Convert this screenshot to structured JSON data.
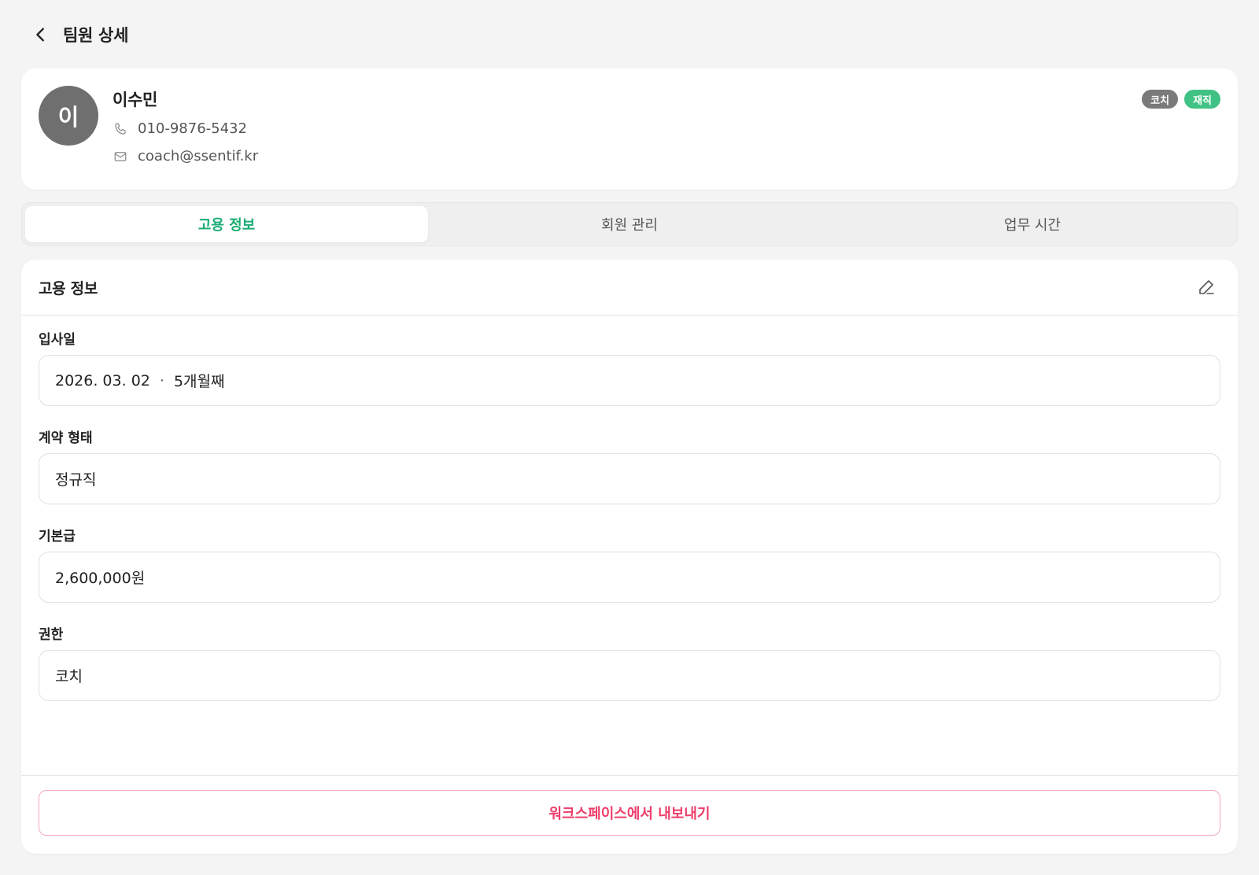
{
  "header": {
    "title": "팀원 상세",
    "back_icon": "chevron-left-icon"
  },
  "profile": {
    "avatar_initial": "이",
    "name": "이수민",
    "phone": "010-9876-5432",
    "email": "coach@ssentif.kr",
    "badges": [
      {
        "label": "코치",
        "color": "#7a7a7a"
      },
      {
        "label": "재직",
        "color": "#41c285"
      }
    ]
  },
  "tabs": [
    {
      "label": "고용 정보",
      "active": true
    },
    {
      "label": "회원 관리",
      "active": false
    },
    {
      "label": "업무 시간",
      "active": false
    }
  ],
  "employment": {
    "title": "고용 정보",
    "fields": {
      "hire_date": {
        "label": "입사일",
        "date": "2026. 03. 02",
        "separator": "·",
        "tenure": "5개월째"
      },
      "contract": {
        "label": "계약 형태",
        "value": "정규직"
      },
      "salary": {
        "label": "기본급",
        "value": "2,600,000원"
      },
      "role": {
        "label": "권한",
        "value": "코치"
      }
    },
    "export_label": "워크스페이스에서 내보내기"
  },
  "colors": {
    "accent": "#1aac72",
    "danger": "#ee3e6a",
    "background": "#f4f4f4"
  }
}
